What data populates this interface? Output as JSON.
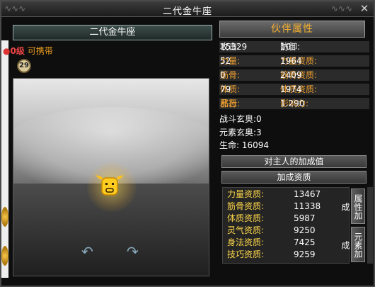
{
  "window": {
    "title": "二代金牛座",
    "close_glyph": "✕"
  },
  "pet": {
    "name": "二代金牛座",
    "level_dot": "●",
    "level": "0级",
    "carry": "可携带",
    "carry_level": "29",
    "rotate_left": "↶",
    "rotate_right": "↷"
  },
  "attributes": {
    "header": "伙伴属性",
    "rows": [
      {
        "a_label": "攻击:",
        "a_value": "15329",
        "b_label": "防御:",
        "b_value": "10"
      },
      {
        "a_label": "力量:",
        "a_value": "52",
        "b_label": "力量资质:",
        "b_value": "1964"
      },
      {
        "a_label": "筋骨:",
        "a_value": "0",
        "b_label": "筋骨资质:",
        "b_value": "2409"
      },
      {
        "a_label": "体质:",
        "a_value": "79",
        "b_label": "体质资质:",
        "b_value": "1974"
      },
      {
        "a_label": "品行:",
        "a_value": "邪恶",
        "b_label": "影响力:",
        "b_value": "1.290"
      }
    ],
    "battle": {
      "label": "战斗玄奥:",
      "value": "0"
    },
    "element": {
      "label": "元素玄奥:",
      "value": "3"
    },
    "life": {
      "label": "生命:",
      "value": " 16094"
    }
  },
  "buttons": {
    "master_bonus": "对主人的加成值",
    "bonus_aptitude": "加成资质"
  },
  "bonus": [
    {
      "label": "力量资质:",
      "value": "13467"
    },
    {
      "label": "筋骨资质:",
      "value": "11338"
    },
    {
      "label": "体质资质:",
      "value": "5987"
    },
    {
      "label": "灵气资质:",
      "value": "9250"
    },
    {
      "label": "身法资质:",
      "value": "7425"
    },
    {
      "label": "技巧资质:",
      "value": "9259"
    }
  ],
  "side_tabs": {
    "attr": "属性加成",
    "element": "元素加成"
  },
  "colors": {
    "label_orange": "#f0a030",
    "header_orange": "#f6b030",
    "level_red": "#e44",
    "bonus_label_yellow": "#ffd84a"
  }
}
